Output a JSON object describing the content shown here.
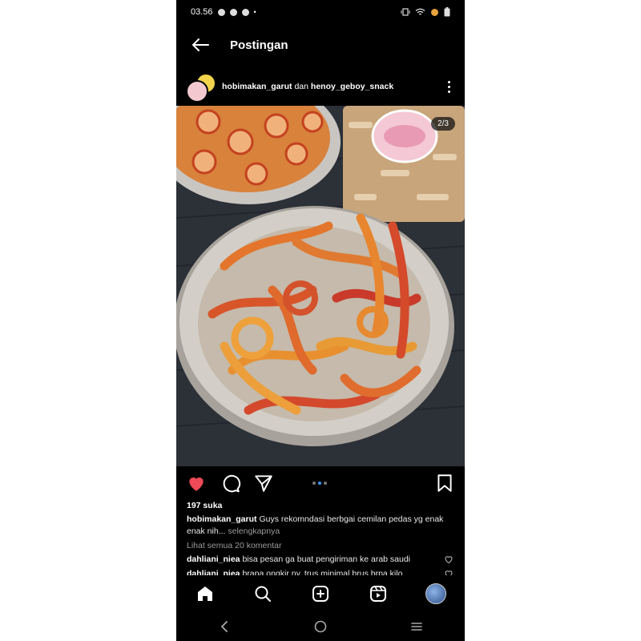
{
  "status_bar": {
    "time": "03.56"
  },
  "header": {
    "title": "Postingan"
  },
  "post": {
    "user1": "hobimakan_garut",
    "conjunction": "dan",
    "user2": "henoy_geboy_snack",
    "image_counter": "2/3",
    "likes": "197 suka",
    "caption_user": "hobimakan_garut",
    "caption_text": "Guys rekomndasi berbgai cemilan pedas yg enak enak nih...",
    "caption_more": "selengkapnya",
    "view_all_comments": "Lihat semua 20 komentar",
    "comments": [
      {
        "user": "dahliani_niea",
        "text": "bisa pesan ga buat pengiriman ke arab saudi"
      },
      {
        "user": "dahliani_niea",
        "text": "brapa ongkir ny, trus minimal brus brpa kilo"
      }
    ]
  },
  "icons": {
    "back": "arrow-left-icon",
    "more": "more-vertical-icon",
    "like": "heart-icon",
    "comment": "comment-icon",
    "share": "send-icon",
    "save": "bookmark-icon",
    "home": "home-icon",
    "search": "search-icon",
    "create": "plus-square-icon",
    "reels": "reels-icon",
    "profile": "avatar"
  },
  "colors": {
    "like": "#ed4956",
    "carousel_active": "#3897f0"
  }
}
